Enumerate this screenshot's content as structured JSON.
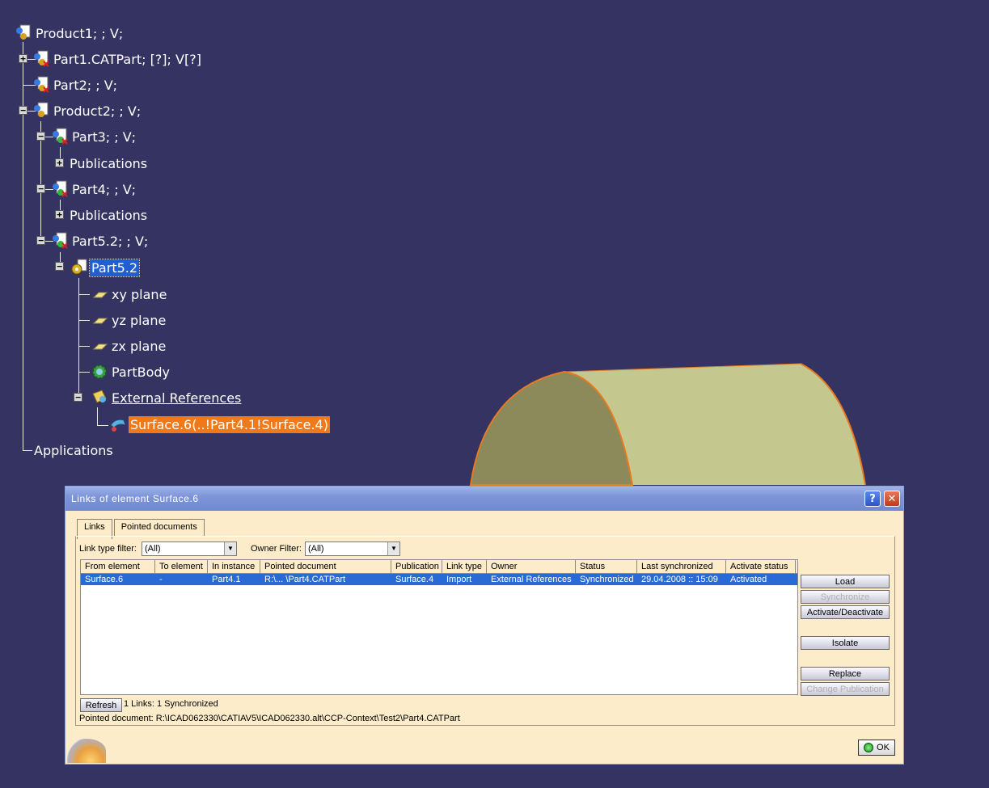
{
  "tree": {
    "items": [
      {
        "label": "Product1; ; V;"
      },
      {
        "label": "Part1.CATPart; [?]; V[?]"
      },
      {
        "label": "Part2; ; V;"
      },
      {
        "label": "Product2; ; V;"
      },
      {
        "label": "Part3; ; V;"
      },
      {
        "label": "Publications"
      },
      {
        "label": "Part4; ; V;"
      },
      {
        "label": "Publications"
      },
      {
        "label": "Part5.2; ; V;"
      },
      {
        "label": "Part5.2"
      },
      {
        "label": "xy plane"
      },
      {
        "label": "yz plane"
      },
      {
        "label": "zx plane"
      },
      {
        "label": "PartBody"
      },
      {
        "label": "External References"
      },
      {
        "label": "Surface.6(..!Part4.1!Surface.4)"
      },
      {
        "label": "Applications"
      }
    ],
    "colors": {
      "background": "#353362",
      "selected_blue": "#1f5fd0",
      "selected_orange": "#f07a1a"
    }
  },
  "dialog": {
    "title": "Links of element Surface.6",
    "help_glyph": "?",
    "close_glyph": "✕",
    "tabs": [
      {
        "label": "Links"
      },
      {
        "label": "Pointed documents"
      }
    ],
    "link_type_filter": {
      "label": "Link type filter:",
      "value": "(All)"
    },
    "owner_filter": {
      "label": "Owner Filter:",
      "value": "(All)"
    },
    "table": {
      "columns": [
        "From element",
        "To element",
        "In instance",
        "Pointed document",
        "Publication",
        "Link type",
        "Owner",
        "Status",
        "Last synchronized",
        "Activate status"
      ],
      "rows": [
        [
          "Surface.6",
          "-",
          "Part4.1",
          "R:\\... \\Part4.CATPart",
          "Surface.4",
          "Import",
          "External References",
          "Synchronized",
          "29.04.2008 :: 15:09",
          "Activated"
        ]
      ]
    },
    "buttons": {
      "load": "Load",
      "synchronize": "Synchronize",
      "activate_deactivate": "Activate/Deactivate",
      "isolate": "Isolate",
      "replace": "Replace",
      "change_publication": "Change Publication",
      "refresh": "Refresh",
      "ok": "OK"
    },
    "summary": "1 Links: 1 Synchronized",
    "pointed_document": "Pointed document: R:\\ICAD062330\\CATIAV5\\ICAD062330.alt\\CCP-Context\\Test2\\Part4.CATPart",
    "colors": {
      "panel": "#fdecc9",
      "row_selected": "#2a6ad6"
    }
  }
}
